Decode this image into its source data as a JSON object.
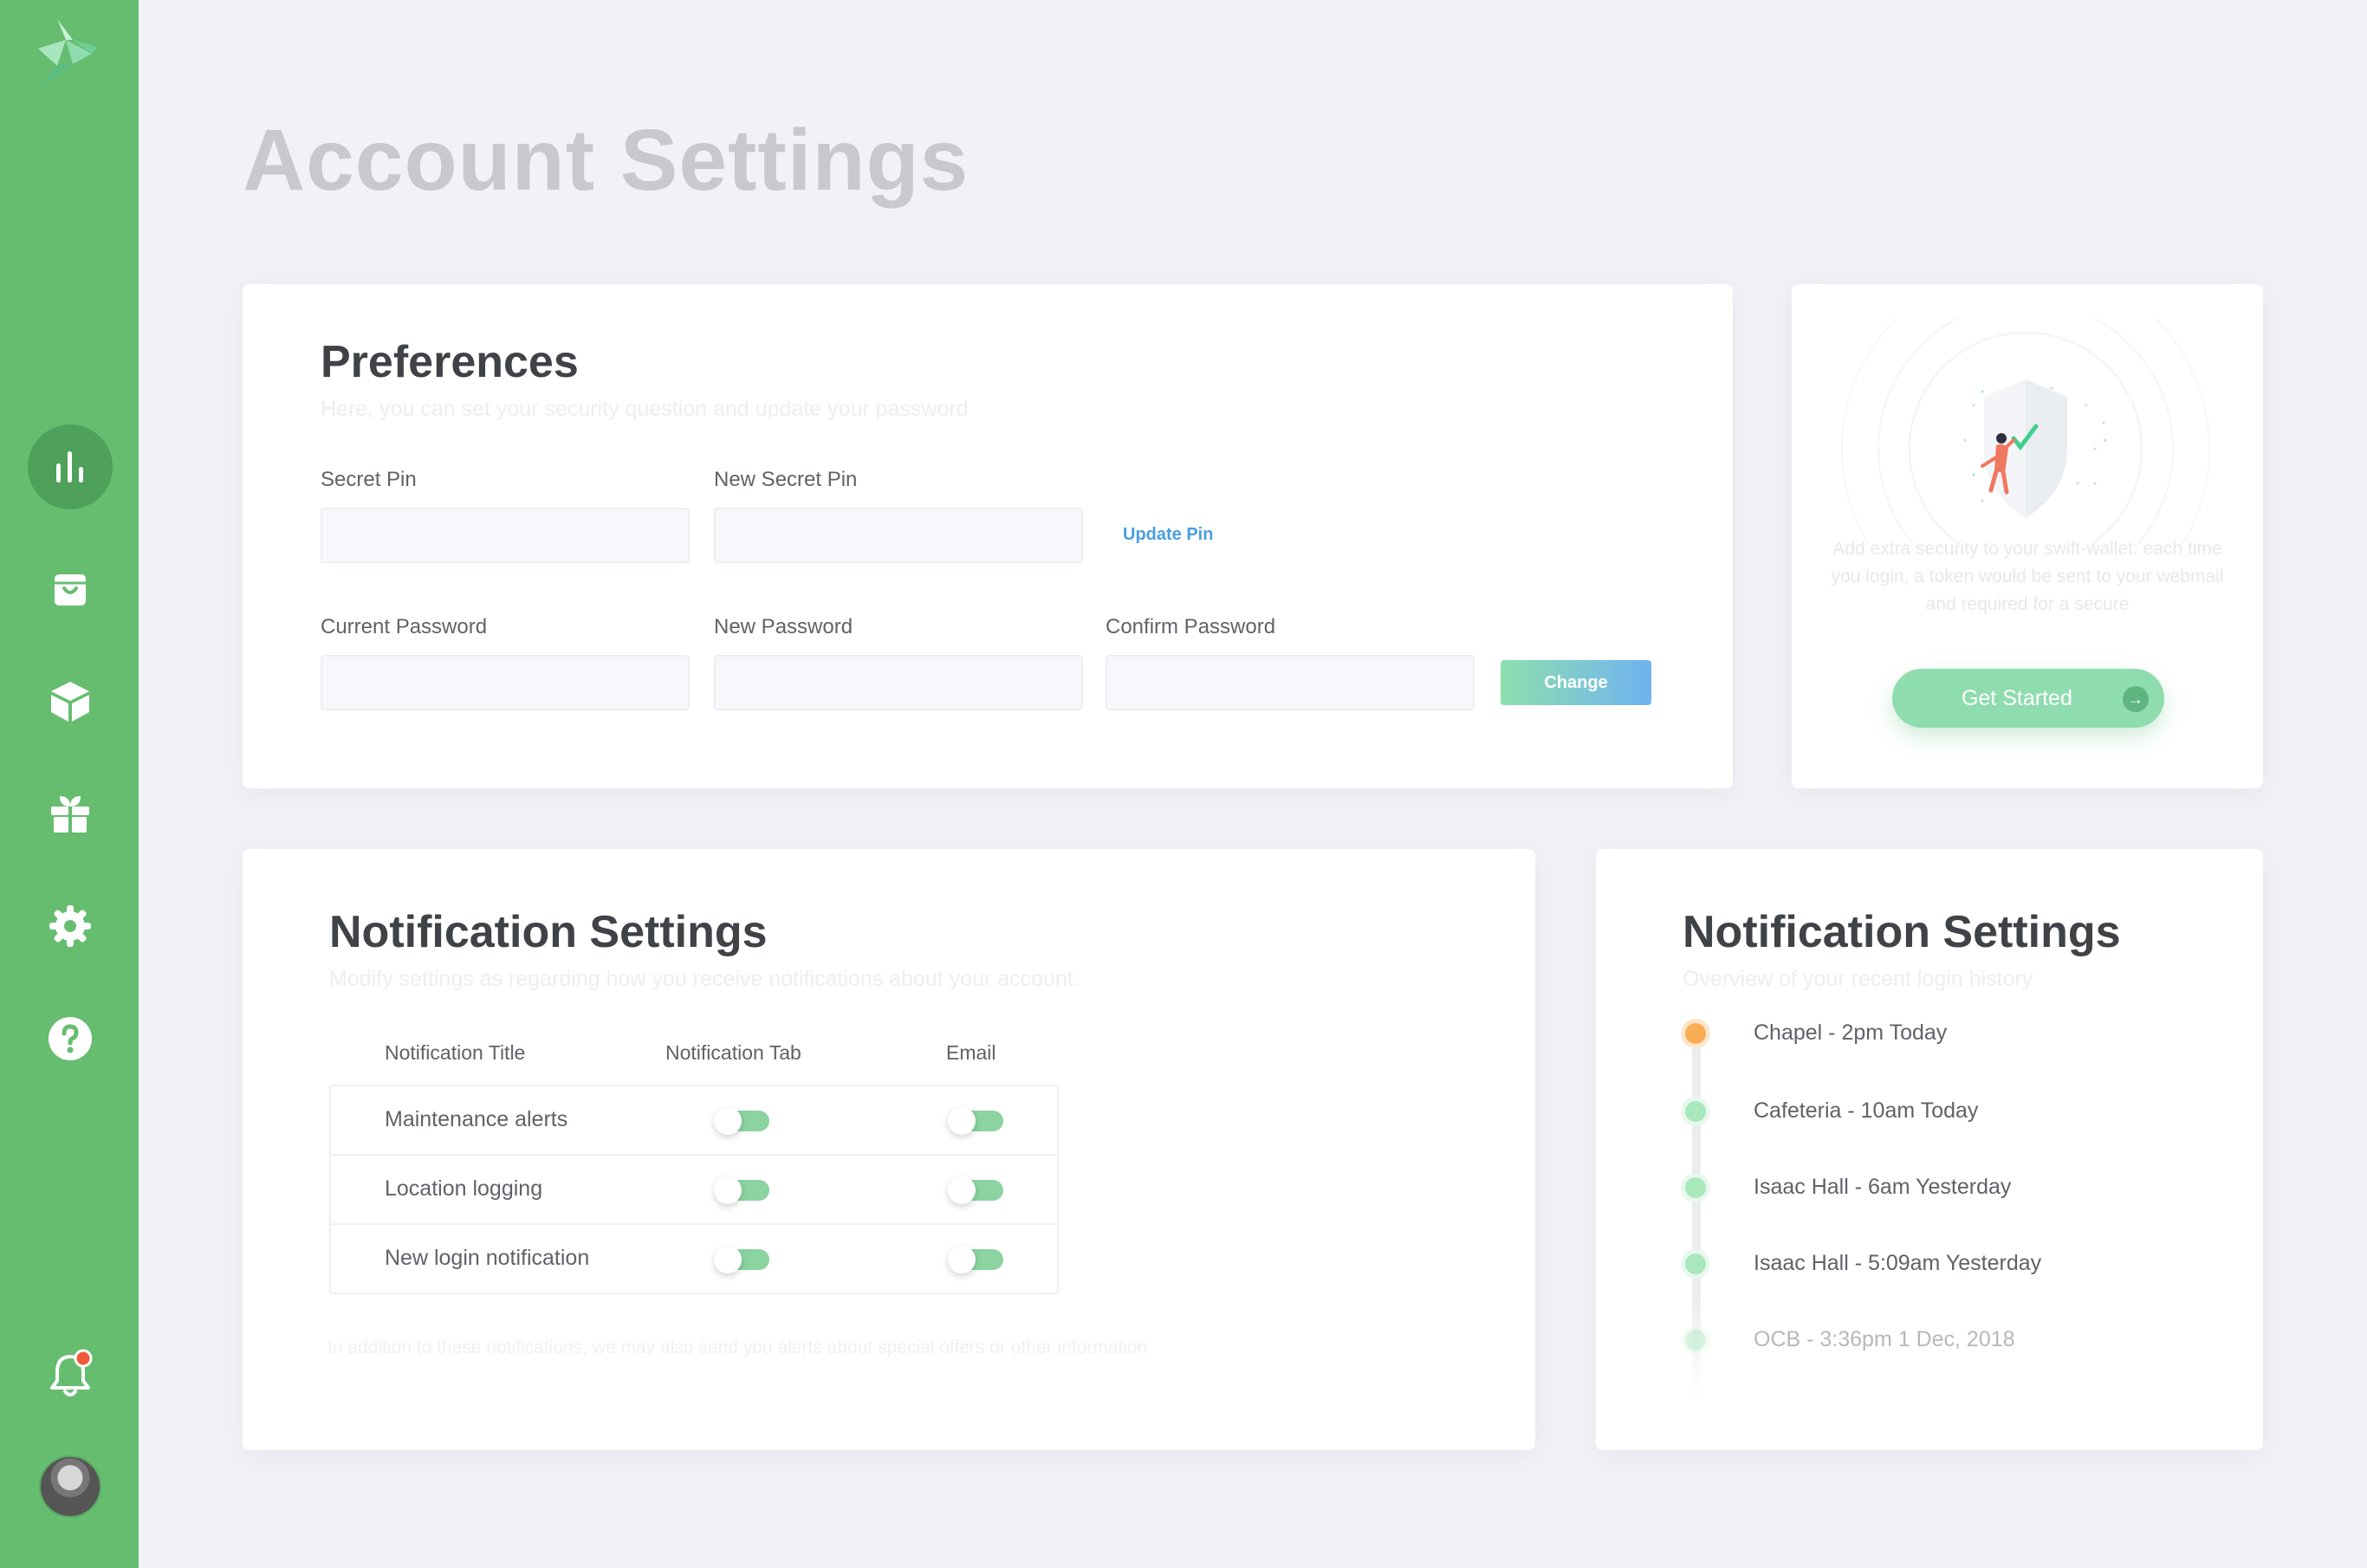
{
  "sidebar": {
    "items": [
      {
        "name": "stats",
        "icon": "bar-chart-icon",
        "active": true
      },
      {
        "name": "shop",
        "icon": "shopping-bag-icon",
        "active": false
      },
      {
        "name": "products",
        "icon": "box-icon",
        "active": false
      },
      {
        "name": "rewards",
        "icon": "gift-icon",
        "active": false
      },
      {
        "name": "settings",
        "icon": "gear-icon",
        "active": false
      },
      {
        "name": "help",
        "icon": "help-icon",
        "active": false
      }
    ],
    "bell_icon": "bell-icon",
    "colors": {
      "background": "#66bd70",
      "active": "#4ea05a",
      "badge": "#f05a3a"
    }
  },
  "page": {
    "title": "Account Settings"
  },
  "preferences": {
    "title": "Preferences",
    "subtitle": "Here, you can set your security question and update your password",
    "secret_pin_label": "Secret Pin",
    "new_secret_pin_label": "New Secret Pin",
    "update_pin_label": "Update Pin",
    "current_password_label": "Current Password",
    "new_password_label": "New Password",
    "confirm_password_label": "Confirm Password",
    "change_label": "Change"
  },
  "security": {
    "text": "Add extra security to your swift-wallet: each time you login, a token would be sent to your webmail and required for a secure",
    "button_label": "Get Started"
  },
  "notifications": {
    "title": "Notification Settings",
    "subtitle": "Modify settings as regarding how you receive notifications about your account.",
    "columns": [
      "Notification Title",
      "Notification Tab",
      "Email"
    ],
    "rows": [
      {
        "title": "Maintenance alerts",
        "tab": true,
        "email": true
      },
      {
        "title": "Location logging",
        "tab": true,
        "email": true
      },
      {
        "title": "New login notification",
        "tab": true,
        "email": true
      }
    ],
    "footer": "In addition to these notifications, we may also send you alerts about special offers or other information"
  },
  "history": {
    "title": "Notification Settings",
    "subtitle": "Overview of your recent login history",
    "items": [
      {
        "text": "Chapel - 2pm Today",
        "status": "current"
      },
      {
        "text": "Cafeteria - 10am Today",
        "status": "past"
      },
      {
        "text": "Isaac Hall - 6am Yesterday",
        "status": "past"
      },
      {
        "text": "Isaac Hall - 5:09am Yesterday",
        "status": "past"
      },
      {
        "text": "OCB - 3:36pm 1 Dec, 2018",
        "status": "faded"
      }
    ]
  }
}
